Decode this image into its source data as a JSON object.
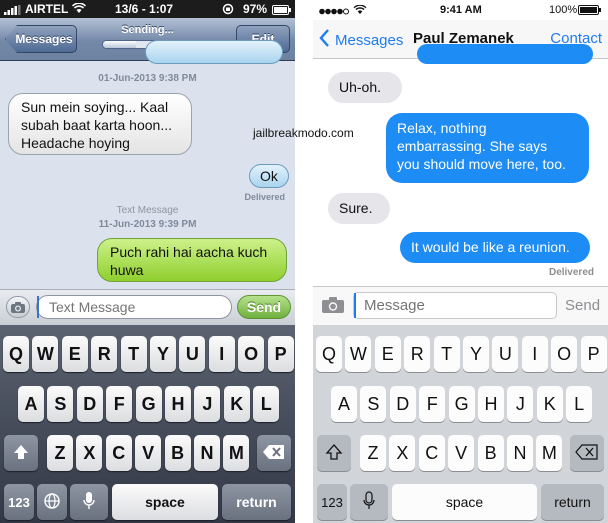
{
  "left": {
    "status": {
      "carrier": "AIRTEL",
      "time": "13/6 - 1:07",
      "battery": "97%"
    },
    "nav": {
      "back_label": "Messages",
      "title": "Sending...",
      "edit_label": "Edit",
      "progress": 0.36
    },
    "messages": [
      {
        "kind": "timestamp",
        "text": "01-Jun-2013 9:38 PM"
      },
      {
        "kind": "in",
        "lines": [
          "Sun mein soying... Kaal",
          "subah baat karta hoon...",
          "Headache hoying"
        ]
      },
      {
        "kind": "out",
        "text": "Ok",
        "status": "Delivered"
      },
      {
        "kind": "label",
        "text": "Text Message"
      },
      {
        "kind": "timestamp",
        "text": "11-Jun-2013 9:39 PM"
      },
      {
        "kind": "out",
        "lines": [
          "Puch rahi hai aacha kuch",
          "huwa"
        ]
      }
    ],
    "input": {
      "placeholder": "Text Message",
      "send_label": "Send"
    },
    "keyboard": {
      "row1": [
        "Q",
        "W",
        "E",
        "R",
        "T",
        "Y",
        "U",
        "I",
        "O",
        "P"
      ],
      "row2": [
        "A",
        "S",
        "D",
        "F",
        "G",
        "H",
        "J",
        "K",
        "L"
      ],
      "row3": [
        "Z",
        "X",
        "C",
        "V",
        "B",
        "N",
        "M"
      ],
      "numbers": "123",
      "space": "space",
      "return": "return"
    }
  },
  "right": {
    "status": {
      "time": "9:41 AM",
      "battery": "100%"
    },
    "nav": {
      "back_label": "Messages",
      "title": "Paul Zemanek",
      "contact_label": "Contact"
    },
    "messages": [
      {
        "kind": "in",
        "text": "Uh-oh."
      },
      {
        "kind": "out",
        "lines": [
          "Relax, nothing",
          "embarrassing. She says",
          "you should move here, too."
        ]
      },
      {
        "kind": "in",
        "text": "Sure."
      },
      {
        "kind": "out",
        "text": "It would be like a reunion.",
        "status": "Delivered"
      }
    ],
    "input": {
      "placeholder": "Message",
      "send_label": "Send"
    },
    "keyboard": {
      "row1": [
        "Q",
        "W",
        "E",
        "R",
        "T",
        "Y",
        "U",
        "I",
        "O",
        "P"
      ],
      "row2": [
        "A",
        "S",
        "D",
        "F",
        "G",
        "H",
        "J",
        "K",
        "L"
      ],
      "row3": [
        "Z",
        "X",
        "C",
        "V",
        "B",
        "N",
        "M"
      ],
      "numbers": "123",
      "space": "space",
      "return": "return"
    }
  },
  "watermark": "jailbreakmodo.com",
  "colors": {
    "ios7_blue": "#1e8cf5",
    "ios6_green": "#8fcf2e",
    "ios7_gray_bubble": "#e5e5ea"
  },
  "icons": [
    "signal-bars-icon",
    "wifi-icon",
    "lock-rotation-icon",
    "battery-icon",
    "back-chevron-icon",
    "camera-icon",
    "shift-icon",
    "globe-icon",
    "mic-icon",
    "delete-icon"
  ]
}
